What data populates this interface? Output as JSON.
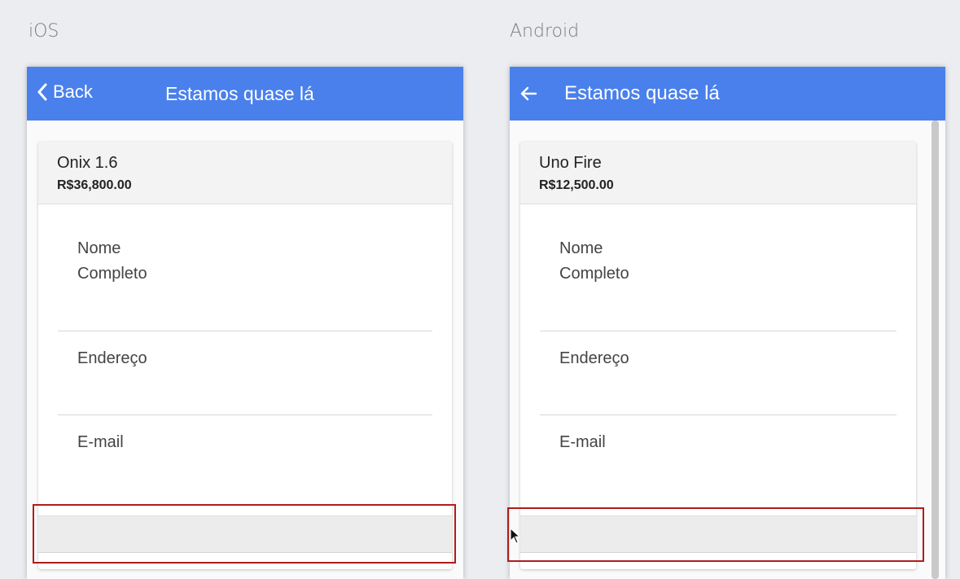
{
  "ios": {
    "platform_label": "iOS",
    "back_label": "Back",
    "title": "Estamos quase lá",
    "car_name": "Onix 1.6",
    "car_price": "R$36,800.00",
    "fields": {
      "name_line1": "Nome",
      "name_line2": "Completo",
      "address": "Endereço",
      "email": "E-mail"
    }
  },
  "android": {
    "platform_label": "Android",
    "title": "Estamos quase lá",
    "car_name": "Uno Fire",
    "car_price": "R$12,500.00",
    "fields": {
      "name_line1": "Nome",
      "name_line2": "Completo",
      "address": "Endereço",
      "email": "E-mail"
    }
  },
  "colors": {
    "navbar": "#4a80ec",
    "highlight": "#b01c1c",
    "background": "#ecedf1"
  }
}
